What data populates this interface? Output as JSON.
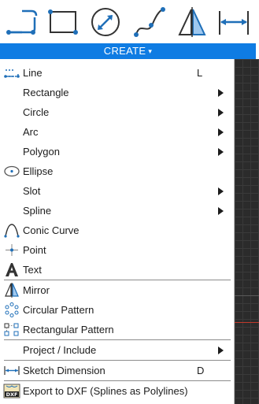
{
  "colors": {
    "accent": "#0f7ce3",
    "icon": "#1f6fb8",
    "menu_bg": "#ffffff",
    "canvas": "#2b2b2b"
  },
  "toolbar": {
    "tools": [
      {
        "icon": "line-tool-icon"
      },
      {
        "icon": "rectangle-tool-icon"
      },
      {
        "icon": "circle-tool-icon"
      },
      {
        "icon": "spline-tool-icon"
      },
      {
        "icon": "mirror-tool-icon"
      },
      {
        "icon": "dimension-tool-icon"
      }
    ],
    "create_label": "CREATE",
    "create_caret": "▾"
  },
  "menu": {
    "items": [
      {
        "label": "Line",
        "shortcut": "L",
        "submenu": false,
        "icon": "line-icon"
      },
      {
        "label": "Rectangle",
        "shortcut": "",
        "submenu": true,
        "icon": ""
      },
      {
        "label": "Circle",
        "shortcut": "",
        "submenu": true,
        "icon": ""
      },
      {
        "label": "Arc",
        "shortcut": "",
        "submenu": true,
        "icon": ""
      },
      {
        "label": "Polygon",
        "shortcut": "",
        "submenu": true,
        "icon": ""
      },
      {
        "label": "Ellipse",
        "shortcut": "",
        "submenu": false,
        "icon": "ellipse-icon"
      },
      {
        "label": "Slot",
        "shortcut": "",
        "submenu": true,
        "icon": ""
      },
      {
        "label": "Spline",
        "shortcut": "",
        "submenu": true,
        "icon": ""
      },
      {
        "label": "Conic Curve",
        "shortcut": "",
        "submenu": false,
        "icon": "conic-curve-icon"
      },
      {
        "label": "Point",
        "shortcut": "",
        "submenu": false,
        "icon": "point-icon"
      },
      {
        "label": "Text",
        "shortcut": "",
        "submenu": false,
        "icon": "text-icon"
      },
      {
        "label": "Mirror",
        "shortcut": "",
        "submenu": false,
        "icon": "mirror-icon"
      },
      {
        "label": "Circular Pattern",
        "shortcut": "",
        "submenu": false,
        "icon": "circular-pattern-icon"
      },
      {
        "label": "Rectangular Pattern",
        "shortcut": "",
        "submenu": false,
        "icon": "rectangular-pattern-icon"
      },
      {
        "label": "Project / Include",
        "shortcut": "",
        "submenu": true,
        "icon": ""
      },
      {
        "label": "Sketch Dimension",
        "shortcut": "D",
        "submenu": false,
        "icon": "sketch-dimension-icon"
      },
      {
        "label": "Export to DXF (Splines as Polylines)",
        "shortcut": "",
        "submenu": false,
        "icon": "dxf-export-icon"
      }
    ]
  }
}
